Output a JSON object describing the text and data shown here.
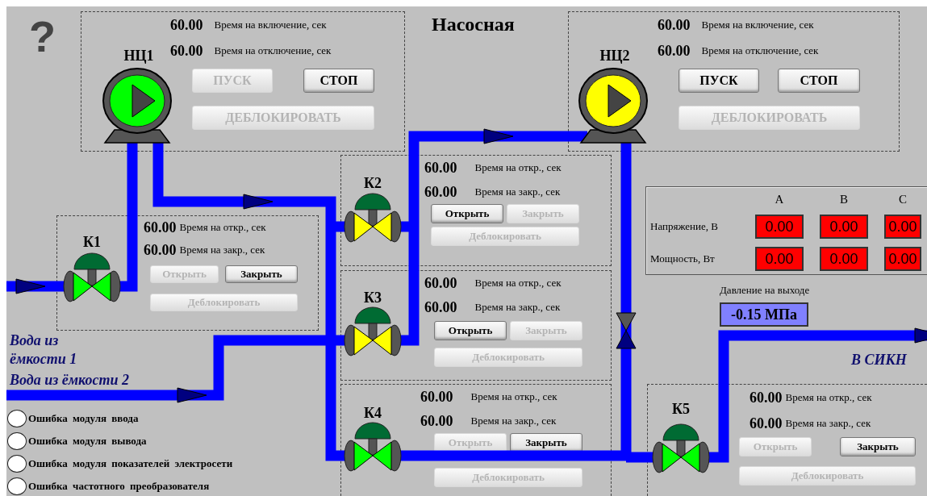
{
  "help": "?",
  "title": "Насосная",
  "pumps": [
    {
      "name": "НЦ1",
      "color": "#00ff00",
      "settings": [
        {
          "value": "60.00",
          "label": "Время на включение, сек"
        },
        {
          "value": "60.00",
          "label": "Время на отключение, сек"
        }
      ],
      "buttons": [
        {
          "label": "ПУСК",
          "disabled": true
        },
        {
          "label": "СТОП",
          "disabled": false
        }
      ],
      "unlock": {
        "label": "ДЕБЛОКИРОВАТЬ",
        "disabled": true
      }
    },
    {
      "name": "НЦ2",
      "color": "#ffff00",
      "settings": [
        {
          "value": "60.00",
          "label": "Время на включение, сек"
        },
        {
          "value": "60.00",
          "label": "Время на отключение, сек"
        }
      ],
      "buttons": [
        {
          "label": "ПУСК",
          "disabled": false
        },
        {
          "label": "СТОП",
          "disabled": false
        }
      ],
      "unlock": {
        "label": "ДЕБЛОКИРОВАТЬ",
        "disabled": true
      }
    }
  ],
  "valves": [
    {
      "name": "К1",
      "color": "#00ff00",
      "settings": [
        {
          "value": "60.00",
          "label": "Время на откр., сек"
        },
        {
          "value": "60.00",
          "label": "Время на закр., сек"
        }
      ],
      "buttons": [
        {
          "label": "Открыть",
          "disabled": true
        },
        {
          "label": "Закрыть",
          "disabled": false
        }
      ],
      "unlock": {
        "label": "Деблокировать",
        "disabled": true
      }
    },
    {
      "name": "К2",
      "color": "#ffff00",
      "settings": [
        {
          "value": "60.00",
          "label": "Время на откр., сек"
        },
        {
          "value": "60.00",
          "label": "Время на закр., сек"
        }
      ],
      "buttons": [
        {
          "label": "Открыть",
          "disabled": false
        },
        {
          "label": "Закрыть",
          "disabled": true
        }
      ],
      "unlock": {
        "label": "Деблокировать",
        "disabled": true
      }
    },
    {
      "name": "К3",
      "color": "#ffff00",
      "settings": [
        {
          "value": "60.00",
          "label": "Время на откр., сек"
        },
        {
          "value": "60.00",
          "label": "Время на закр., сек"
        }
      ],
      "buttons": [
        {
          "label": "Открыть",
          "disabled": false
        },
        {
          "label": "Закрыть",
          "disabled": true
        }
      ],
      "unlock": {
        "label": "Деблокировать",
        "disabled": true
      }
    },
    {
      "name": "К4",
      "color": "#00ff00",
      "settings": [
        {
          "value": "60.00",
          "label": "Время на откр., сек"
        },
        {
          "value": "60.00",
          "label": "Время на закр., сек"
        }
      ],
      "buttons": [
        {
          "label": "Открыть",
          "disabled": true
        },
        {
          "label": "Закрыть",
          "disabled": false
        }
      ],
      "unlock": {
        "label": "Деблокировать",
        "disabled": true
      }
    },
    {
      "name": "К5",
      "color": "#00ff00",
      "settings": [
        {
          "value": "60.00",
          "label": "Время на откр., сек"
        },
        {
          "value": "60.00",
          "label": "Время на закр., сек"
        }
      ],
      "buttons": [
        {
          "label": "Открыть",
          "disabled": true
        },
        {
          "label": "Закрыть",
          "disabled": false
        }
      ],
      "unlock": {
        "label": "Деблокировать",
        "disabled": true
      }
    }
  ],
  "power": {
    "columns": [
      "A",
      "B",
      "C"
    ],
    "rows": [
      {
        "label": "Напряжение, В",
        "values": [
          "0.00",
          "0.00",
          "0.00"
        ]
      },
      {
        "label": "Мощность, Вт",
        "values": [
          "0.00",
          "0.00",
          "0.00"
        ]
      }
    ]
  },
  "pressure": {
    "label": "Давление на выходе",
    "value": "-0.15 МПа"
  },
  "flow_labels": [
    "Вода из ёмкости 1",
    "Вода из ёмкости 2",
    "В СИКН"
  ],
  "alarms": [
    {
      "label": "Ошибка модуля ввода",
      "active": false
    },
    {
      "label": "Ошибка модуля вывода",
      "active": false
    },
    {
      "label": "Ошибка модуля показателей электросети",
      "active": false
    },
    {
      "label": "Ошибка частотного преобразователя",
      "active": false
    }
  ]
}
